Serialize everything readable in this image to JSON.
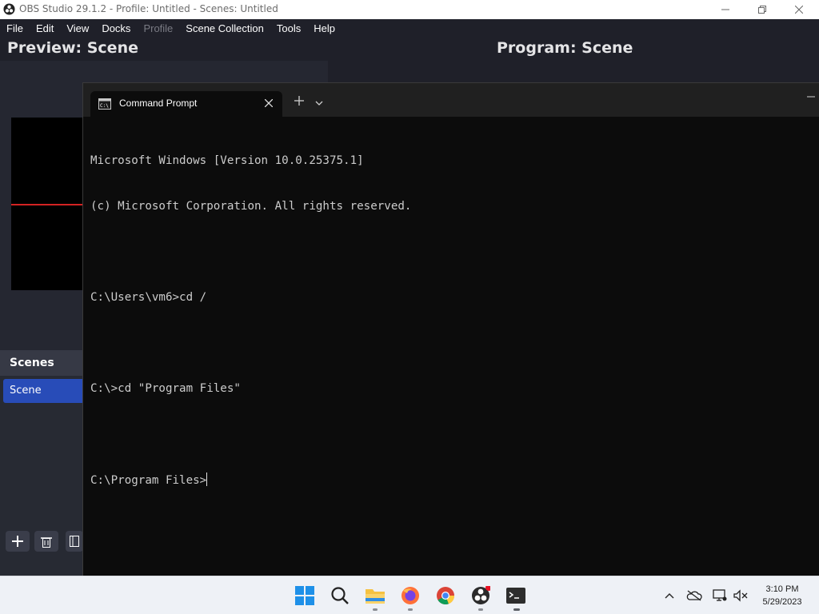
{
  "obs": {
    "title": "OBS Studio 29.1.2 - Profile: Untitled - Scenes: Untitled",
    "menu": [
      "File",
      "Edit",
      "View",
      "Docks",
      "Profile",
      "Scene Collection",
      "Tools",
      "Help"
    ],
    "menu_disabled": [
      "Profile"
    ],
    "preview_title": "Preview: Scene",
    "program_title": "Program: Scene",
    "scenes_header": "Scenes",
    "scenes": [
      "Scene"
    ],
    "selected_scene": "Scene",
    "icons": {
      "logo": "obs-logo-icon",
      "add": "plus-icon",
      "remove": "trash-icon",
      "filter": "filter-icon"
    }
  },
  "terminal": {
    "tab_label": "Command Prompt",
    "icons": {
      "tab": "cmd-icon",
      "close": "close-icon",
      "new_tab": "plus-icon",
      "dropdown": "chevron-down-icon",
      "minimize": "minimize-icon"
    },
    "lines": [
      "Microsoft Windows [Version 10.0.25375.1]",
      "(c) Microsoft Corporation. All rights reserved.",
      "",
      "C:\\Users\\vm6>cd /",
      "",
      "C:\\>cd \"Program Files\"",
      "",
      "C:\\Program Files>"
    ],
    "colors": {
      "background": "#0c0c0c",
      "foreground": "#cccccc",
      "tab_bar": "#202020"
    }
  },
  "taskbar": {
    "apps": [
      "windows-start-icon",
      "search-icon",
      "file-explorer-icon",
      "firefox-icon",
      "chrome-icon",
      "obs-studio-icon",
      "terminal-icon"
    ],
    "tray": [
      "chevron-up-icon",
      "onedrive-icon",
      "network-icon",
      "volume-muted-icon"
    ],
    "time": "3:10 PM",
    "date": "5/29/2023"
  },
  "colors": {
    "obs_background": "#1f2029",
    "accent": "#284cb8",
    "preview_line": "#d32222"
  }
}
